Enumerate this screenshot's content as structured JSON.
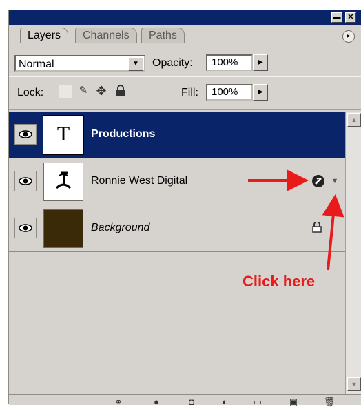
{
  "titlebar": {
    "minimize_label": "▬",
    "close_label": "✕"
  },
  "tabs": [
    {
      "label": "Layers",
      "active": true
    },
    {
      "label": "Channels",
      "active": false
    },
    {
      "label": "Paths",
      "active": false
    }
  ],
  "panel_menu_label": "▸",
  "blend_mode": {
    "value": "Normal"
  },
  "opacity": {
    "label": "Opacity:",
    "value": "100%"
  },
  "lock": {
    "label": "Lock:"
  },
  "fill": {
    "label": "Fill:",
    "value": "100%"
  },
  "layers": [
    {
      "name": "Productions",
      "type": "text",
      "thumb_text": "T",
      "selected": true
    },
    {
      "name": "Ronnie West Digital",
      "type": "shape",
      "selected": false,
      "has_effects": true
    },
    {
      "name": "Background",
      "type": "image",
      "selected": false,
      "locked": true,
      "thumb_color": "#3a2a07"
    }
  ],
  "annotation": {
    "text": "Click here",
    "color": "#e81a1a"
  },
  "colors": {
    "titlebar": "#0a246a",
    "panel": "#d6d3ce",
    "selected_row": "#0a246a"
  }
}
